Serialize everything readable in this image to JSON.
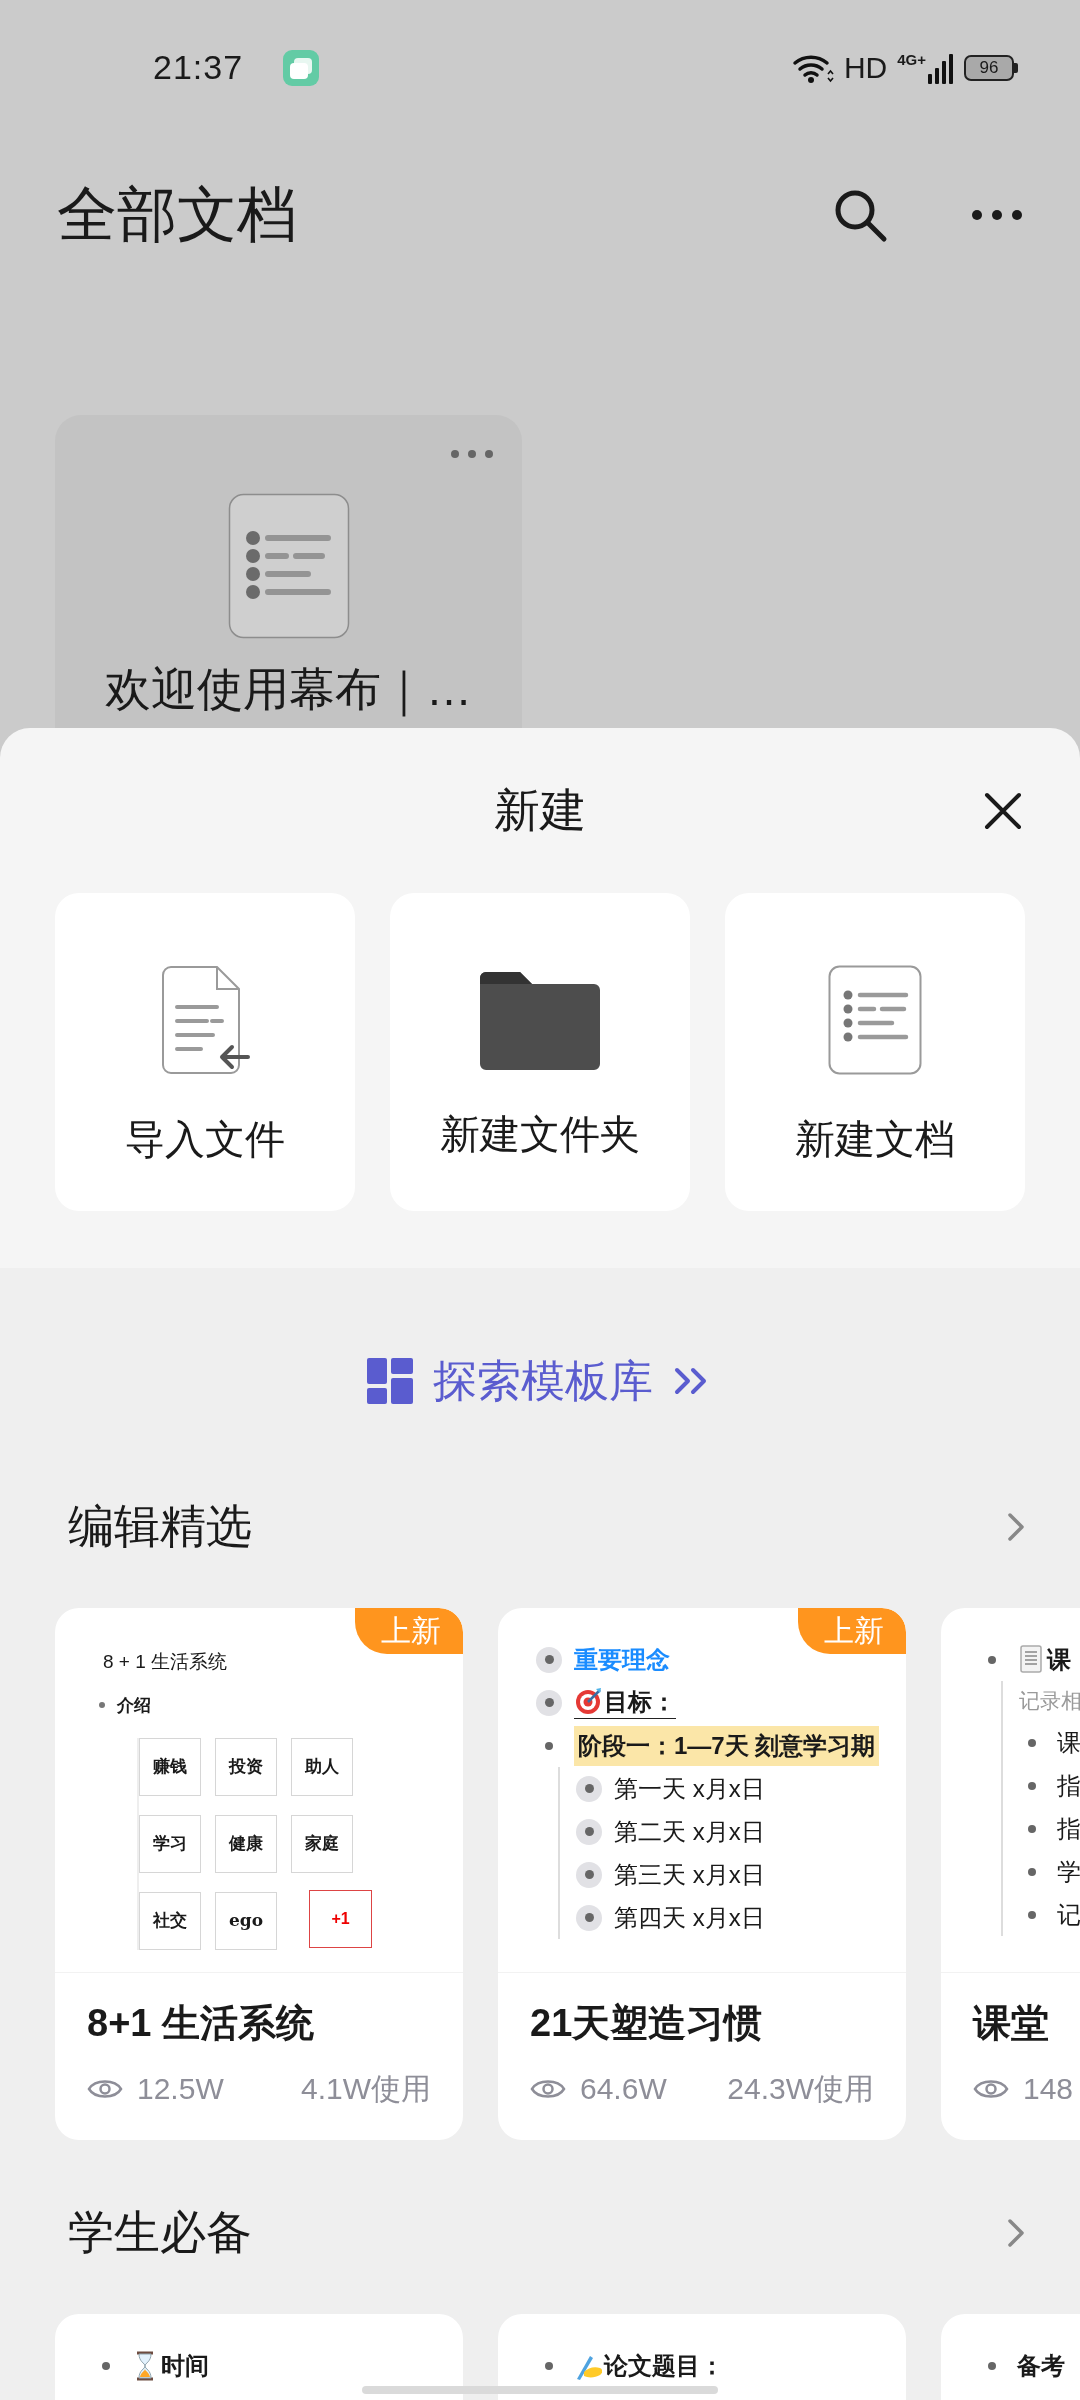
{
  "status_bar": {
    "time": "21:37",
    "network": "HD",
    "cellular": "4G+",
    "battery": "96"
  },
  "header": {
    "title": "全部文档"
  },
  "documents": [
    {
      "title": "欢迎使用幕布｜…"
    }
  ],
  "new_sheet": {
    "title": "新建",
    "actions": [
      {
        "kind": "import",
        "label": "导入文件"
      },
      {
        "kind": "folder",
        "label": "新建文件夹"
      },
      {
        "kind": "document",
        "label": "新建文档"
      }
    ]
  },
  "explore_link": {
    "label": "探索模板库"
  },
  "sections": [
    {
      "title": "编辑精选",
      "cards": [
        {
          "badge": "上新",
          "title": "8+1 生活系统",
          "views": "12.5W",
          "uses": "4.1W使用",
          "preview": {
            "kind": "grid",
            "heading": "8 + 1 生活系统",
            "bullet": "介绍",
            "cells": [
              "赚钱",
              "投资",
              "助人",
              "学习",
              "健康",
              "家庭",
              "社交",
              "ego"
            ],
            "extra": "+1"
          }
        },
        {
          "badge": "上新",
          "title": "21天塑造习惯",
          "views": "64.6W",
          "uses": "24.3W使用",
          "preview": {
            "kind": "outline",
            "lines": [
              {
                "kind": "link",
                "text": "重要理念",
                "collapsed": true
              },
              {
                "kind": "goal",
                "text": "目标：",
                "collapsed": true
              },
              {
                "kind": "highlight",
                "text": "阶段一：1—7天 刻意学习期",
                "collapsed": false,
                "children": [
                  {
                    "text": "第一天 x月x日",
                    "collapsed": true
                  },
                  {
                    "text": "第二天 x月x日",
                    "collapsed": true
                  },
                  {
                    "text": "第三天 x月x日",
                    "collapsed": true
                  },
                  {
                    "text": "第四天 x月x日",
                    "collapsed": true
                  }
                ]
              }
            ]
          }
        },
        {
          "title": "课堂",
          "views": "148",
          "preview": {
            "kind": "outline",
            "lines": [
              {
                "kind": "doc",
                "text": "课",
                "collapsed": false,
                "note": "记录相",
                "children": [
                  {
                    "text": "课",
                    "collapsed": false
                  },
                  {
                    "text": "指",
                    "collapsed": false
                  },
                  {
                    "text": "指",
                    "collapsed": false
                  },
                  {
                    "text": "学",
                    "collapsed": false
                  },
                  {
                    "text": "记",
                    "collapsed": false
                  }
                ]
              }
            ]
          }
        }
      ]
    },
    {
      "title": "学生必备",
      "cards": [
        {
          "preview": {
            "kind": "outline",
            "lines": [
              {
                "kind": "time",
                "text": "时间",
                "collapsed": false
              }
            ]
          }
        },
        {
          "preview": {
            "kind": "outline",
            "lines": [
              {
                "kind": "write",
                "text": "论文题目：",
                "collapsed": false
              }
            ]
          }
        },
        {
          "preview": {
            "kind": "outline",
            "lines": [
              {
                "kind": "plain",
                "text": "备考",
                "collapsed": false
              }
            ]
          }
        }
      ]
    }
  ]
}
